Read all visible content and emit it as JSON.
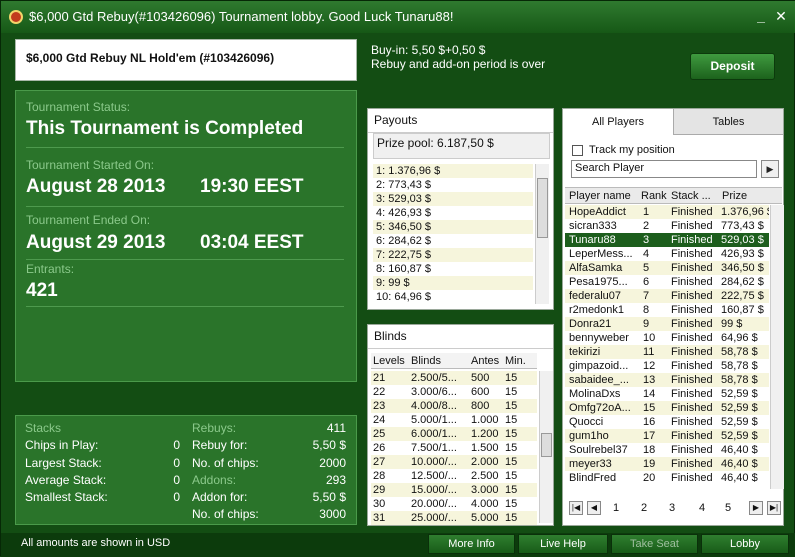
{
  "window": {
    "title": "$6,000 Gtd Rebuy(#103426096) Tournament lobby. Good Luck Tunaru88!"
  },
  "header": {
    "name": "$6,000 Gtd Rebuy NL Hold'em (#103426096)",
    "buyin": "Buy-in: 5,50 $+0,50 $",
    "rebuy_note": "Rebuy and add-on period is over",
    "deposit_label": "Deposit"
  },
  "status": {
    "status_label": "Tournament Status:",
    "status_value": "This Tournament is Completed",
    "started_label": "Tournament Started On:",
    "started_date": "August 28 2013",
    "started_time": "19:30 EEST",
    "ended_label": "Tournament Ended On:",
    "ended_date": "August 29 2013",
    "ended_time": "03:04 EEST",
    "entrants_label": "Entrants:",
    "entrants_value": "421"
  },
  "stacks": {
    "title": "Stacks",
    "chips_label": "Chips in Play:",
    "chips_value": "0",
    "largest_label": "Largest Stack:",
    "largest_value": "0",
    "average_label": "Average Stack:",
    "average_value": "0",
    "smallest_label": "Smallest Stack:",
    "smallest_value": "0"
  },
  "rebuys": {
    "title": "Rebuys:",
    "count": "411",
    "rebuy_for_label": "Rebuy for:",
    "rebuy_for_value": "5,50 $",
    "chips_label": "No. of chips:",
    "chips_value": "2000"
  },
  "addons": {
    "title": "Addons:",
    "count": "293",
    "addon_for_label": "Addon for:",
    "addon_for_value": "5,50 $",
    "chips_label": "No. of chips:",
    "chips_value": "3000"
  },
  "payouts": {
    "title": "Payouts",
    "prize_pool": "Prize pool: 6.187,50 $",
    "rows": [
      "1: 1.376,96 $",
      "2: 773,43 $",
      "3: 529,03 $",
      "4: 426,93 $",
      "5: 346,50 $",
      "6: 284,62 $",
      "7: 222,75 $",
      "8: 160,87 $",
      "9: 99 $",
      "10: 64,96 $"
    ]
  },
  "blinds": {
    "title": "Blinds",
    "headers": [
      "Levels",
      "Blinds",
      "Antes",
      "Min."
    ],
    "rows": [
      [
        "21",
        "2.500/5...",
        "500",
        "15"
      ],
      [
        "22",
        "3.000/6...",
        "600",
        "15"
      ],
      [
        "23",
        "4.000/8...",
        "800",
        "15"
      ],
      [
        "24",
        "5.000/1...",
        "1.000",
        "15"
      ],
      [
        "25",
        "6.000/1...",
        "1.200",
        "15"
      ],
      [
        "26",
        "7.500/1...",
        "1.500",
        "15"
      ],
      [
        "27",
        "10.000/...",
        "2.000",
        "15"
      ],
      [
        "28",
        "12.500/...",
        "2.500",
        "15"
      ],
      [
        "29",
        "15.000/...",
        "3.000",
        "15"
      ],
      [
        "30",
        "20.000/...",
        "4.000",
        "15"
      ],
      [
        "31",
        "25.000/...",
        "5.000",
        "15"
      ]
    ]
  },
  "players": {
    "tab_all": "All Players",
    "tab_tables": "Tables",
    "track_label": "Track my position",
    "search_value": "Search Player",
    "headers": [
      "Player name",
      "Rank",
      "Stack ...",
      "Prize"
    ],
    "rows": [
      [
        "HopeAddict",
        "1",
        "Finished",
        "1.376,96 $"
      ],
      [
        "sicran333",
        "2",
        "Finished",
        "773,43 $"
      ],
      [
        "Tunaru88",
        "3",
        "Finished",
        "529,03 $"
      ],
      [
        "LeperMess...",
        "4",
        "Finished",
        "426,93 $"
      ],
      [
        "AlfaSamka",
        "5",
        "Finished",
        "346,50 $"
      ],
      [
        "Pesa1975...",
        "6",
        "Finished",
        "284,62 $"
      ],
      [
        "federalu07",
        "7",
        "Finished",
        "222,75 $"
      ],
      [
        "r2medonk1",
        "8",
        "Finished",
        "160,87 $"
      ],
      [
        "Donra21",
        "9",
        "Finished",
        "99 $"
      ],
      [
        "bennyweber",
        "10",
        "Finished",
        "64,96 $"
      ],
      [
        "tekirizi",
        "11",
        "Finished",
        "58,78 $"
      ],
      [
        "gimpazoid...",
        "12",
        "Finished",
        "58,78 $"
      ],
      [
        "sabaidee_...",
        "13",
        "Finished",
        "58,78 $"
      ],
      [
        "MolinaDxs",
        "14",
        "Finished",
        "52,59 $"
      ],
      [
        "Omfg72oA...",
        "15",
        "Finished",
        "52,59 $"
      ],
      [
        "Quocci",
        "16",
        "Finished",
        "52,59 $"
      ],
      [
        "gum1ho",
        "17",
        "Finished",
        "52,59 $"
      ],
      [
        "Soulrebel37",
        "18",
        "Finished",
        "46,40 $"
      ],
      [
        "meyer33",
        "19",
        "Finished",
        "46,40 $"
      ],
      [
        "BlindFred",
        "20",
        "Finished",
        "46,40 $"
      ]
    ],
    "selected_player": "Tunaru88",
    "pages": [
      "1",
      "2",
      "3",
      "4",
      "5"
    ]
  },
  "footer": {
    "note": "All amounts are shown in USD",
    "more_info": "More Info",
    "live_help": "Live Help",
    "take_seat": "Take Seat",
    "lobby": "Lobby"
  }
}
